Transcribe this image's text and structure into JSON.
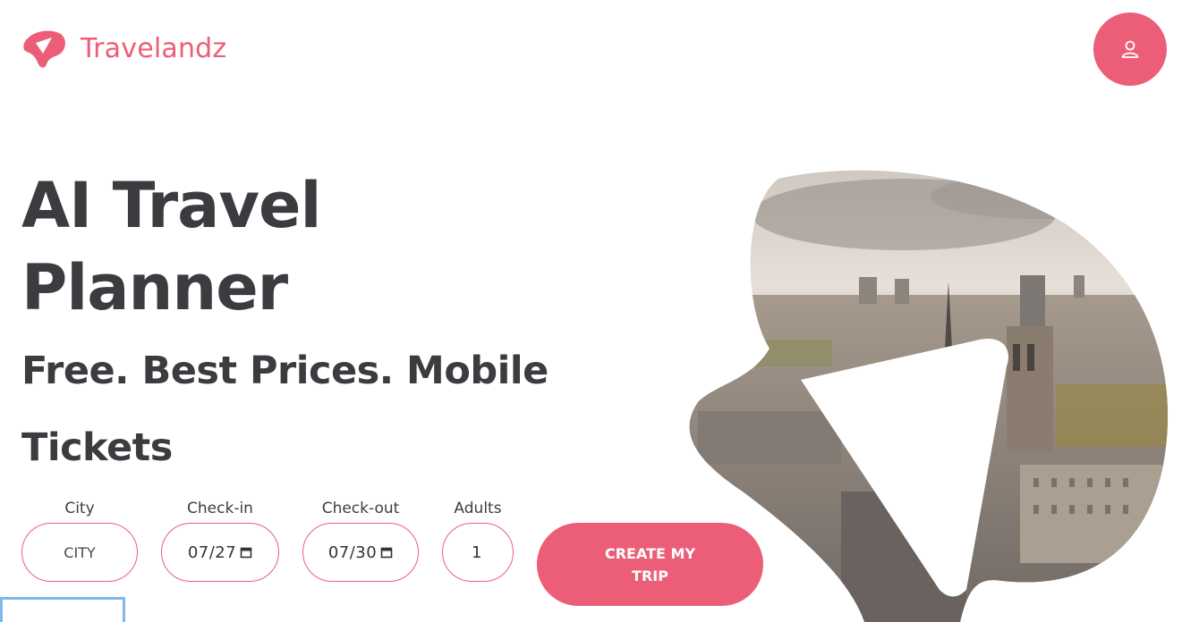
{
  "header": {
    "brand_name": "Travelandz",
    "brand_icon": "travelandz-logo-icon",
    "profile_icon": "user-icon"
  },
  "hero": {
    "title_line1": "AI Travel",
    "title_line2": "Planner",
    "subtitle_line1": "Free. Best Prices. Mobile",
    "subtitle_line2": "Tickets"
  },
  "form": {
    "city": {
      "label": "City",
      "placeholder": "CITY",
      "value": ""
    },
    "checkin": {
      "label": "Check-in",
      "value": "07/27"
    },
    "checkout": {
      "label": "Check-out",
      "value": "07/30"
    },
    "adults": {
      "label": "Adults",
      "value": "1"
    },
    "submit_label": "CREATE MY TRIP"
  },
  "colors": {
    "accent": "#ec5e78",
    "text": "#3b3c40",
    "focus": "#7fb7ee"
  }
}
